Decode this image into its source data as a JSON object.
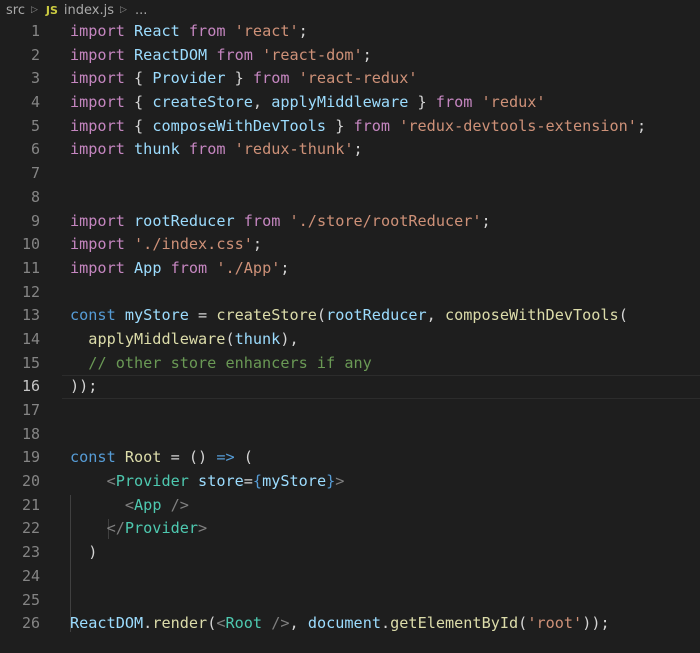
{
  "breadcrumb": {
    "folder": "src",
    "file_badge": "JS",
    "file": "index.js",
    "more": "..."
  },
  "active_line": 16,
  "lines": [
    {
      "n": "1",
      "tokens": [
        [
          "kw",
          "import"
        ],
        [
          "pn",
          " "
        ],
        [
          "var",
          "React"
        ],
        [
          "pn",
          " "
        ],
        [
          "kw",
          "from"
        ],
        [
          "pn",
          " "
        ],
        [
          "str",
          "'react'"
        ],
        [
          "pn",
          ";"
        ]
      ]
    },
    {
      "n": "2",
      "tokens": [
        [
          "kw",
          "import"
        ],
        [
          "pn",
          " "
        ],
        [
          "var",
          "ReactDOM"
        ],
        [
          "pn",
          " "
        ],
        [
          "kw",
          "from"
        ],
        [
          "pn",
          " "
        ],
        [
          "str",
          "'react-dom'"
        ],
        [
          "pn",
          ";"
        ]
      ]
    },
    {
      "n": "3",
      "tokens": [
        [
          "kw",
          "import"
        ],
        [
          "pn",
          " { "
        ],
        [
          "var",
          "Provider"
        ],
        [
          "pn",
          " } "
        ],
        [
          "kw",
          "from"
        ],
        [
          "pn",
          " "
        ],
        [
          "str",
          "'react-redux'"
        ]
      ]
    },
    {
      "n": "4",
      "tokens": [
        [
          "kw",
          "import"
        ],
        [
          "pn",
          " { "
        ],
        [
          "var",
          "createStore"
        ],
        [
          "pn",
          ", "
        ],
        [
          "var",
          "applyMiddleware"
        ],
        [
          "pn",
          " } "
        ],
        [
          "kw",
          "from"
        ],
        [
          "pn",
          " "
        ],
        [
          "str",
          "'redux'"
        ]
      ]
    },
    {
      "n": "5",
      "tokens": [
        [
          "kw",
          "import"
        ],
        [
          "pn",
          " { "
        ],
        [
          "var",
          "composeWithDevTools"
        ],
        [
          "pn",
          " } "
        ],
        [
          "kw",
          "from"
        ],
        [
          "pn",
          " "
        ],
        [
          "str",
          "'redux-devtools-extension'"
        ],
        [
          "pn",
          ";"
        ]
      ]
    },
    {
      "n": "6",
      "tokens": [
        [
          "kw",
          "import"
        ],
        [
          "pn",
          " "
        ],
        [
          "var",
          "thunk"
        ],
        [
          "pn",
          " "
        ],
        [
          "kw",
          "from"
        ],
        [
          "pn",
          " "
        ],
        [
          "str",
          "'redux-thunk'"
        ],
        [
          "pn",
          ";"
        ]
      ]
    },
    {
      "n": "7",
      "tokens": []
    },
    {
      "n": "8",
      "tokens": []
    },
    {
      "n": "9",
      "tokens": [
        [
          "kw",
          "import"
        ],
        [
          "pn",
          " "
        ],
        [
          "var",
          "rootReducer"
        ],
        [
          "pn",
          " "
        ],
        [
          "kw",
          "from"
        ],
        [
          "pn",
          " "
        ],
        [
          "str",
          "'./store/rootReducer'"
        ],
        [
          "pn",
          ";"
        ]
      ]
    },
    {
      "n": "10",
      "tokens": [
        [
          "kw",
          "import"
        ],
        [
          "pn",
          " "
        ],
        [
          "str",
          "'./index.css'"
        ],
        [
          "pn",
          ";"
        ]
      ]
    },
    {
      "n": "11",
      "tokens": [
        [
          "kw",
          "import"
        ],
        [
          "pn",
          " "
        ],
        [
          "var",
          "App"
        ],
        [
          "pn",
          " "
        ],
        [
          "kw",
          "from"
        ],
        [
          "pn",
          " "
        ],
        [
          "str",
          "'./App'"
        ],
        [
          "pn",
          ";"
        ]
      ]
    },
    {
      "n": "12",
      "tokens": []
    },
    {
      "n": "13",
      "tokens": [
        [
          "bk",
          "const"
        ],
        [
          "pn",
          " "
        ],
        [
          "var",
          "myStore"
        ],
        [
          "pn",
          " = "
        ],
        [
          "fn",
          "createStore"
        ],
        [
          "pn",
          "("
        ],
        [
          "var",
          "rootReducer"
        ],
        [
          "pn",
          ", "
        ],
        [
          "fn",
          "composeWithDevTools"
        ],
        [
          "pn",
          "("
        ]
      ]
    },
    {
      "n": "14",
      "tokens": [
        [
          "pn",
          "  "
        ],
        [
          "fn",
          "applyMiddleware"
        ],
        [
          "pn",
          "("
        ],
        [
          "var",
          "thunk"
        ],
        [
          "pn",
          "),"
        ]
      ]
    },
    {
      "n": "15",
      "tokens": [
        [
          "pn",
          "  "
        ],
        [
          "cm",
          "// other store enhancers if any"
        ]
      ]
    },
    {
      "n": "16",
      "tokens": [
        [
          "pn",
          "));"
        ]
      ]
    },
    {
      "n": "17",
      "tokens": []
    },
    {
      "n": "18",
      "tokens": []
    },
    {
      "n": "19",
      "tokens": [
        [
          "bk",
          "const"
        ],
        [
          "pn",
          " "
        ],
        [
          "fn",
          "Root"
        ],
        [
          "pn",
          " = () "
        ],
        [
          "bk",
          "=>"
        ],
        [
          "pn",
          " ("
        ]
      ]
    },
    {
      "n": "20",
      "tokens": [
        [
          "pn",
          "    "
        ],
        [
          "ang",
          "<"
        ],
        [
          "tag",
          "Provider"
        ],
        [
          "pn",
          " "
        ],
        [
          "var",
          "store"
        ],
        [
          "pn",
          "="
        ],
        [
          "brc",
          "{"
        ],
        [
          "var",
          "myStore"
        ],
        [
          "brc",
          "}"
        ],
        [
          "ang",
          ">"
        ]
      ]
    },
    {
      "n": "21",
      "tokens": [
        [
          "pn",
          "      "
        ],
        [
          "ang",
          "<"
        ],
        [
          "tag",
          "App"
        ],
        [
          "pn",
          " "
        ],
        [
          "ang",
          "/>"
        ]
      ]
    },
    {
      "n": "22",
      "tokens": [
        [
          "pn",
          "    "
        ],
        [
          "ang",
          "</"
        ],
        [
          "tag",
          "Provider"
        ],
        [
          "ang",
          ">"
        ]
      ]
    },
    {
      "n": "23",
      "tokens": [
        [
          "pn",
          "  )"
        ]
      ]
    },
    {
      "n": "24",
      "tokens": []
    },
    {
      "n": "25",
      "tokens": []
    },
    {
      "n": "26",
      "tokens": [
        [
          "var",
          "ReactDOM"
        ],
        [
          "pn",
          "."
        ],
        [
          "fn",
          "render"
        ],
        [
          "pn",
          "("
        ],
        [
          "ang",
          "<"
        ],
        [
          "tag",
          "Root"
        ],
        [
          "pn",
          " "
        ],
        [
          "ang",
          "/>"
        ],
        [
          "pn",
          ", "
        ],
        [
          "var",
          "document"
        ],
        [
          "pn",
          "."
        ],
        [
          "fn",
          "getElementById"
        ],
        [
          "pn",
          "("
        ],
        [
          "str",
          "'root'"
        ],
        [
          "pn",
          "));"
        ]
      ]
    }
  ]
}
